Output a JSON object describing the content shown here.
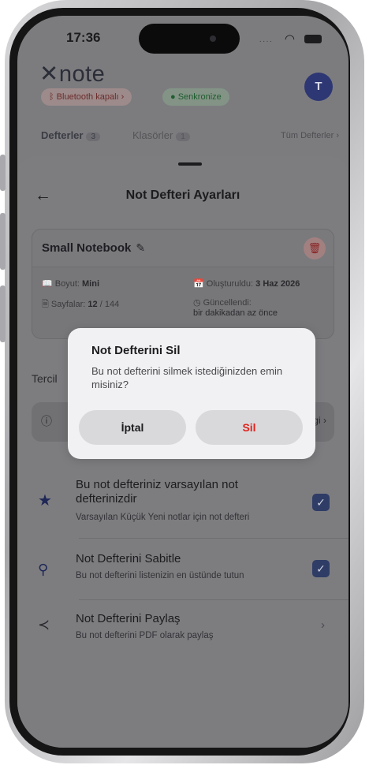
{
  "status_bar": {
    "time": "17:36"
  },
  "header": {
    "logo": "note",
    "avatar_initial": "T"
  },
  "chips": {
    "bluetooth": "Bluetooth kapalı",
    "sync": "Senkronize"
  },
  "tabs": {
    "notebooks": {
      "label": "Defterler",
      "count": "3"
    },
    "folders": {
      "label": "Klasörler",
      "count": "1"
    },
    "all_link": "Tüm Defterler"
  },
  "sheet": {
    "title": "Not Defteri Ayarları",
    "notebook": {
      "name": "Small Notebook",
      "size_label": "Boyut:",
      "size_value": "Mini",
      "pages_label": "Sayfalar:",
      "pages_value": "12",
      "pages_total": "/ 144",
      "created_label": "Oluşturuldu:",
      "created_value": "3 Haz 2026",
      "updated_label": "Güncellendi:",
      "updated_value": "bir dakikadan az önce"
    },
    "prefs_label": "Tercil",
    "info_link": "lgi",
    "settings": [
      {
        "title": "Bu not defteriniz varsayılan not defterinizdir",
        "desc": "Varsayılan Küçük Yeni notlar için not defteri"
      },
      {
        "title": "Not Defterini Sabitle",
        "desc": "Bu not defterini listenizin en üstünde tutun"
      },
      {
        "title": "Not Defterini Paylaş",
        "desc": "Bu not defterini PDF olarak paylaş"
      }
    ]
  },
  "dialog": {
    "title": "Not Defterini Sil",
    "message": "Bu not defterini silmek istediğinizden emin misiniz?",
    "cancel": "İptal",
    "delete": "Sil"
  }
}
